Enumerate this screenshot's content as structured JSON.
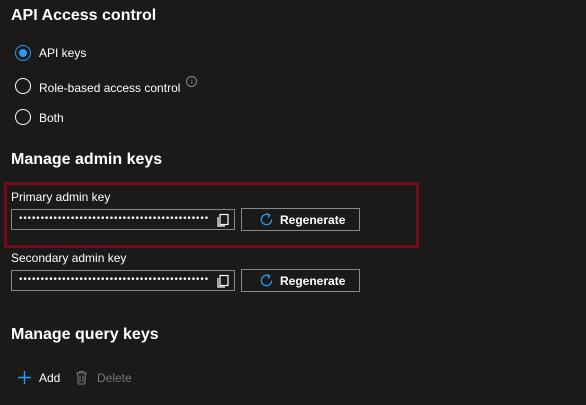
{
  "api_access": {
    "title": "API Access control",
    "options": [
      {
        "label": "API keys",
        "checked": true
      },
      {
        "label": "Role-based access control",
        "checked": false,
        "info": "i"
      },
      {
        "label": "Both",
        "checked": false
      }
    ]
  },
  "admin_keys": {
    "title": "Manage admin keys",
    "primary": {
      "label": "Primary admin key",
      "value": "••••••••••••••••••••••••••••••••••••••••••••",
      "regenerate_label": "Regenerate"
    },
    "secondary": {
      "label": "Secondary admin key",
      "value": "••••••••••••••••••••••••••••••••••••••••••••",
      "regenerate_label": "Regenerate"
    }
  },
  "query_keys": {
    "title": "Manage query keys",
    "add_label": "Add",
    "delete_label": "Delete"
  },
  "colors": {
    "background": "#1b1a19",
    "accent": "#2899f5",
    "highlight": "#750b1c",
    "disabled": "#797775"
  },
  "icons": [
    "info-icon",
    "copy-icon",
    "refresh-icon",
    "plus-icon",
    "trash-icon"
  ]
}
